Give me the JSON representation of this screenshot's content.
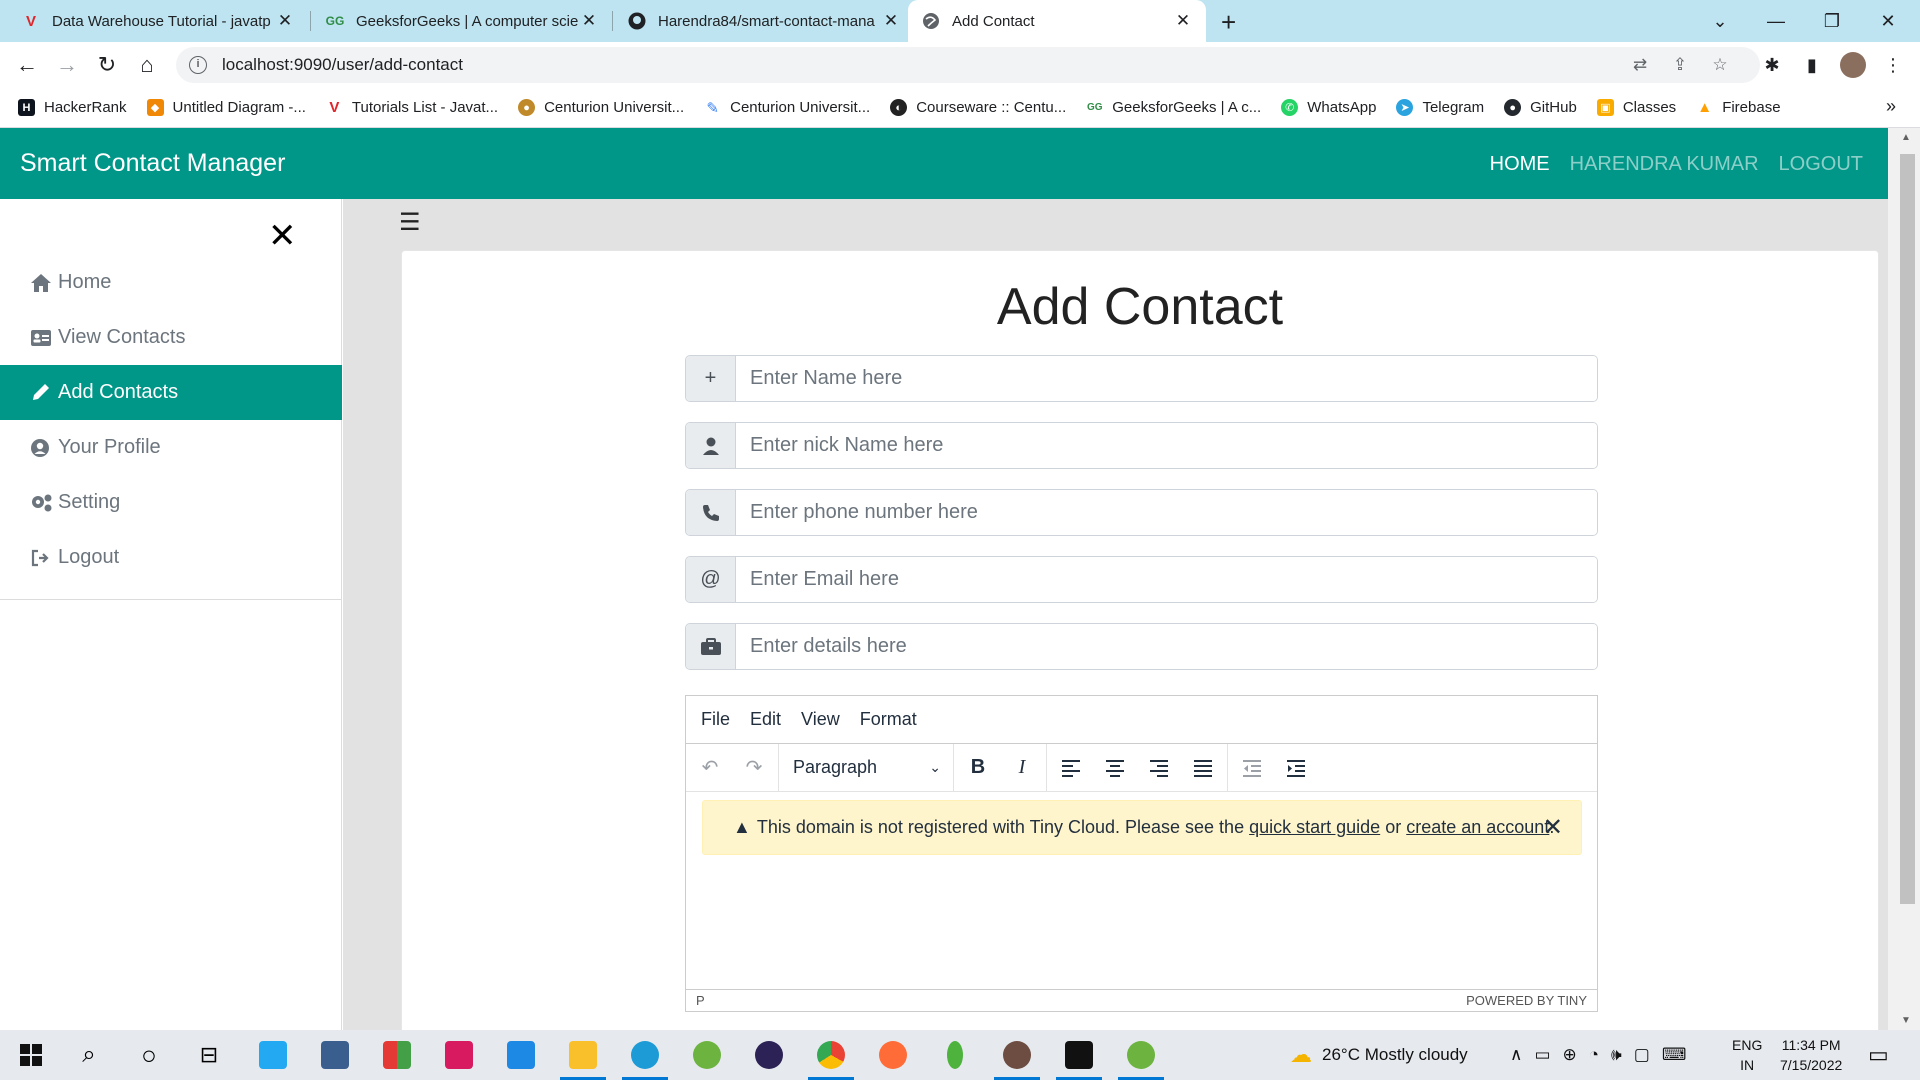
{
  "browser": {
    "tabs": [
      {
        "title": "Data Warehouse Tutorial - javatp",
        "icon": "javatpoint-icon",
        "active": false
      },
      {
        "title": "GeeksforGeeks | A computer scie",
        "icon": "geeksforgeeks-icon",
        "active": false
      },
      {
        "title": "Harendra84/smart-contact-mana",
        "icon": "github-icon",
        "active": false
      },
      {
        "title": "Add Contact",
        "icon": "globe-icon",
        "active": true
      }
    ],
    "url": "localhost:9090/user/add-contact",
    "bookmarks": [
      {
        "label": "HackerRank",
        "icon": "hackerrank-icon",
        "color": "#0e141e"
      },
      {
        "label": "Untitled Diagram -...",
        "icon": "drawio-icon",
        "color": "#f08705"
      },
      {
        "label": "Tutorials List - Javat...",
        "icon": "javatpoint-icon",
        "color": "#e0252b"
      },
      {
        "label": "Centurion Universit...",
        "icon": "university-icon",
        "color": "#c08a2a"
      },
      {
        "label": "Centurion Universit...",
        "icon": "pen-icon",
        "color": "#3b82f6"
      },
      {
        "label": "Courseware :: Centu...",
        "icon": "courseware-icon",
        "color": "#222222"
      },
      {
        "label": "GeeksforGeeks | A c...",
        "icon": "geeksforgeeks-icon",
        "color": "#2f8d46"
      },
      {
        "label": "WhatsApp",
        "icon": "whatsapp-icon",
        "color": "#25d366"
      },
      {
        "label": "Telegram",
        "icon": "telegram-icon",
        "color": "#2aa3df"
      },
      {
        "label": "GitHub",
        "icon": "github-icon",
        "color": "#24292f"
      },
      {
        "label": "Classes",
        "icon": "classroom-icon",
        "color": "#f9ab00"
      },
      {
        "label": "Firebase",
        "icon": "firebase-icon",
        "color": "#ffa000"
      }
    ]
  },
  "app": {
    "brand": "Smart Contact Manager",
    "nav": {
      "home": "HOME",
      "user": "HARENDRA KUMAR",
      "logout": "LOGOUT"
    },
    "accent_color": "#009688"
  },
  "sidebar": {
    "items": [
      {
        "label": "Home",
        "icon": "home-icon",
        "active": false
      },
      {
        "label": "View Contacts",
        "icon": "address-card-icon",
        "active": false
      },
      {
        "label": "Add Contacts",
        "icon": "pencil-icon",
        "active": true
      },
      {
        "label": "Your Profile",
        "icon": "user-circle-icon",
        "active": false
      },
      {
        "label": "Setting",
        "icon": "cogs-icon",
        "active": false
      },
      {
        "label": "Logout",
        "icon": "sign-out-icon",
        "active": false
      }
    ]
  },
  "form": {
    "heading": "Add Contact",
    "fields": [
      {
        "placeholder": "Enter Name here",
        "icon": "plus-icon",
        "value": ""
      },
      {
        "placeholder": "Enter nick Name here",
        "icon": "user-icon",
        "value": ""
      },
      {
        "placeholder": "Enter phone number here",
        "icon": "phone-icon",
        "value": ""
      },
      {
        "placeholder": "Enter Email here",
        "icon": "at-icon",
        "value": ""
      },
      {
        "placeholder": "Enter details here",
        "icon": "briefcase-icon",
        "value": ""
      }
    ]
  },
  "editor": {
    "menu": [
      "File",
      "Edit",
      "View",
      "Format"
    ],
    "block_format": "Paragraph",
    "notice": {
      "before": "This domain is not registered with Tiny Cloud. Please see the",
      "link1": "quick start guide",
      "middle": "or",
      "link2": "create an account",
      "after": "."
    },
    "status_path": "P",
    "powered_by": "POWERED BY TINY"
  },
  "taskbar": {
    "weather": "26°C  Mostly cloudy",
    "lang_top": "ENG",
    "lang_bottom": "IN",
    "time": "11:34 PM",
    "date": "7/15/2022"
  }
}
